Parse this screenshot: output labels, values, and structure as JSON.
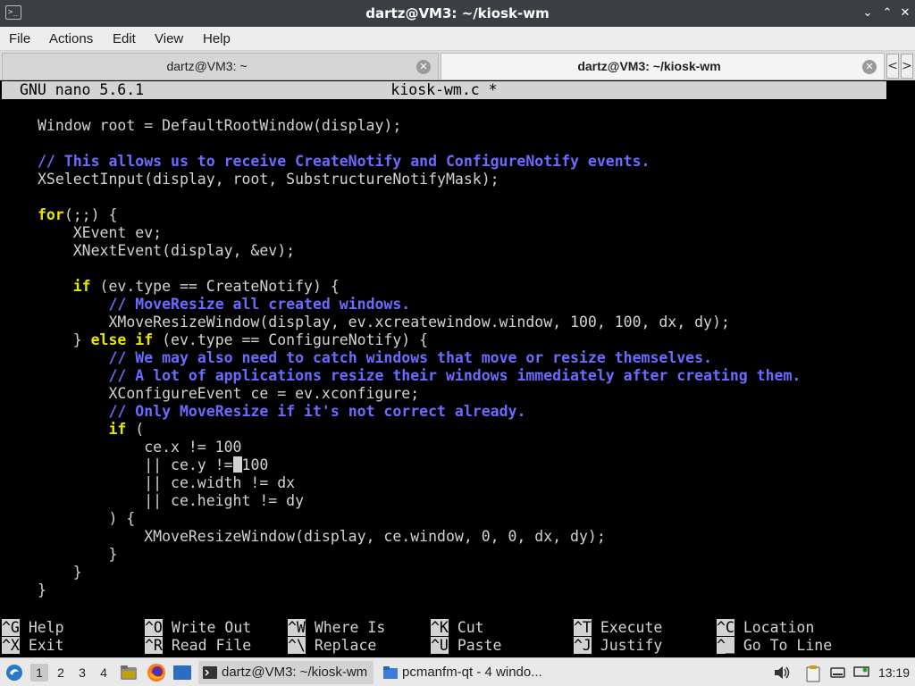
{
  "window": {
    "title": "dartz@VM3: ~/kiosk-wm",
    "controls": {
      "minimize": "⌄",
      "maximize": "⌃",
      "close": "✕"
    }
  },
  "menu": [
    "File",
    "Actions",
    "Edit",
    "View",
    "Help"
  ],
  "tabs": [
    {
      "label": "dartz@VM3: ~",
      "active": false
    },
    {
      "label": "dartz@VM3: ~/kiosk-wm",
      "active": true
    }
  ],
  "tab_nav": {
    "prev": "<",
    "next": ">"
  },
  "nano": {
    "version": "GNU nano 5.6.1",
    "filename": "kiosk-wm.c *"
  },
  "code_lines": [
    "Window root = DefaultRootWindow(display);",
    "",
    "// This allows us to receive CreateNotify and ConfigureNotify events.",
    "XSelectInput(display, root, SubstructureNotifyMask);",
    "",
    "for(;;) {",
    "    XEvent ev;",
    "    XNextEvent(display, &ev);",
    "",
    "    if (ev.type == CreateNotify) {",
    "        // MoveResize all created windows.",
    "        XMoveResizeWindow(display, ev.xcreatewindow.window, 100, 100, dx, dy);",
    "    } else if (ev.type == ConfigureNotify) {",
    "        // We may also need to catch windows that move or resize themselves.",
    "        // A lot of applications resize their windows immediately after creating them.",
    "        XConfigureEvent ce = ev.xconfigure;",
    "        // Only MoveResize if it's not correct already.",
    "        if (",
    "            ce.x != 100",
    "            || ce.y != 100",
    "            || ce.width != dx",
    "            || ce.height != dy",
    "        ) {",
    "            XMoveResizeWindow(display, ce.window, 0, 0, dx, dy);",
    "        }",
    "    }",
    "}"
  ],
  "shortcuts": [
    {
      "key": "^G",
      "label": "Help"
    },
    {
      "key": "^X",
      "label": "Exit"
    },
    {
      "key": "^O",
      "label": "Write Out"
    },
    {
      "key": "^R",
      "label": "Read File"
    },
    {
      "key": "^W",
      "label": "Where Is"
    },
    {
      "key": "^\\",
      "label": "Replace"
    },
    {
      "key": "^K",
      "label": "Cut"
    },
    {
      "key": "^U",
      "label": "Paste"
    },
    {
      "key": "^T",
      "label": "Execute"
    },
    {
      "key": "^J",
      "label": "Justify"
    },
    {
      "key": "^C",
      "label": "Location"
    },
    {
      "key": "^_",
      "label": "Go To Line"
    }
  ],
  "taskbar": {
    "workspaces": [
      "1",
      "2",
      "3",
      "4"
    ],
    "active_workspace": "1",
    "tasks": [
      {
        "label": "dartz@VM3: ~/kiosk-wm",
        "icon": "terminal-icon",
        "active": true
      },
      {
        "label": "pcmanfm-qt - 4 windo...",
        "icon": "folder-icon",
        "active": false
      }
    ],
    "tray_icons": [
      "clipboard-icon",
      "battery-icon",
      "network-icon",
      "volume-icon"
    ],
    "clock": "13:19"
  },
  "colors": {
    "comment": "#6b6bff",
    "keyword": "#e6e600",
    "terminal_text": "#d3d3d3",
    "terminal_bg": "#000000",
    "titlebar": "#3c3f41"
  }
}
